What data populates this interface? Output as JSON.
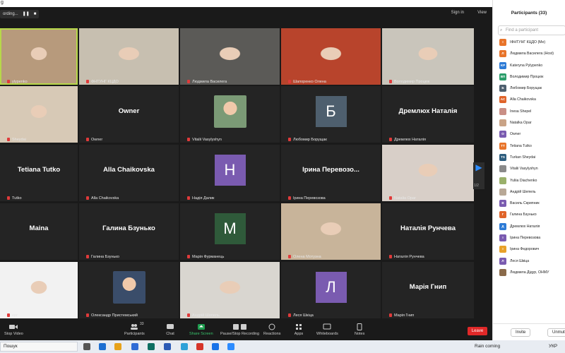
{
  "window": {
    "title": "g"
  },
  "recording": {
    "label": "ording...",
    "pause": "❚❚",
    "stop": "■"
  },
  "top_right": {
    "sign_in": "Sign in",
    "view": "View"
  },
  "tiles": [
    {
      "id": "t1",
      "name": "ylypenko",
      "kind": "video",
      "bg": "#b79a7c",
      "active": true
    },
    {
      "id": "t2",
      "name": "ФНТУНГ КЦДО",
      "kind": "video",
      "bg": "#c7bfb0"
    },
    {
      "id": "t3",
      "name": "Людмила Василега",
      "kind": "video",
      "bg": "#5b5a57"
    },
    {
      "id": "t4",
      "name": "Шапоренко Олена",
      "kind": "video",
      "bg": "#b8442c"
    },
    {
      "id": "t5",
      "name": "Володимир Процюк",
      "kind": "video",
      "bg": "#c9c5bb"
    },
    {
      "id": "t6",
      "name": "Shеydai",
      "kind": "video",
      "bg": "#d7c9b6"
    },
    {
      "id": "t7",
      "name": "Owner",
      "kind": "text",
      "big": "Owner"
    },
    {
      "id": "t8",
      "name": "Vitalii Vasylyshyn",
      "kind": "photo",
      "bg": "#7b9a76"
    },
    {
      "id": "t9",
      "name": "Любомир Борущак",
      "kind": "avatar",
      "letter": "Б",
      "bg": "#4e5f6e"
    },
    {
      "id": "t10",
      "name": "Дремлюх Наталія",
      "kind": "text",
      "big": "Дремлюх Наталія"
    },
    {
      "id": "t11",
      "name": "Tutko",
      "kind": "text",
      "big": "Tetiana Tutko"
    },
    {
      "id": "t12",
      "name": "Alla Chaikovska",
      "kind": "text",
      "big": "Alla Chaikovska"
    },
    {
      "id": "t13",
      "name": "Надія Далик",
      "kind": "avatar",
      "letter": "Н",
      "bg": "#7a5bb0"
    },
    {
      "id": "t14",
      "name": "Ірина Перевозова",
      "kind": "text",
      "big": "Ірина  Перевозо..."
    },
    {
      "id": "t15",
      "name": "Natalia Opar",
      "kind": "video",
      "bg": "#d8cfc8"
    },
    {
      "id": "t16",
      "name": "",
      "kind": "text",
      "big": "Maina"
    },
    {
      "id": "t17",
      "name": "Галина Бзунько",
      "kind": "text",
      "big": "Галина Бзунько"
    },
    {
      "id": "t18",
      "name": "Марія Фурманець",
      "kind": "avatar",
      "letter": "М",
      "bg": "#2f5a3a"
    },
    {
      "id": "t19",
      "name": "Олена Мотузна",
      "kind": "video",
      "bg": "#c8b49a"
    },
    {
      "id": "t20",
      "name": "Наталія Рунчева",
      "kind": "text",
      "big": "Наталія Рунчева"
    },
    {
      "id": "t21",
      "name": "ерг",
      "kind": "video",
      "bg": "#f2f2f2"
    },
    {
      "id": "t22",
      "name": "Олександр Пристемський",
      "kind": "photo",
      "bg": "#3a4d6a"
    },
    {
      "id": "t23",
      "name": "Андрій Шепель",
      "kind": "video",
      "bg": "#d9d6d0"
    },
    {
      "id": "t24",
      "name": "Леся Шкіца",
      "kind": "avatar",
      "letter": "Л",
      "bg": "#7a5bb0"
    },
    {
      "id": "t25",
      "name": "Марія Гнип",
      "kind": "text",
      "big": "Марія Гнип"
    }
  ],
  "pager": {
    "arrow": "▶",
    "page": "1/2"
  },
  "toolbar": {
    "stop_video": "Stop Video",
    "participants": "Participants",
    "participants_count": "33",
    "chat": "Chat",
    "share_screen": "Share Screen",
    "pause_recording": "Pause/Stop Recording",
    "reactions": "Reactions",
    "apps": "Apps",
    "whiteboards": "Whiteboards",
    "notes": "Notes",
    "leave": "Leave"
  },
  "panel": {
    "title": "Participants (33)",
    "search_placeholder": "Find a participant",
    "invite": "Invite",
    "unmute": "Unmute"
  },
  "participants": [
    {
      "initials": "I",
      "name": "ІФНТУНГ КЦДО (Me)",
      "color": "#e8742a"
    },
    {
      "initials": "Л",
      "name": "Людмила Василега (Host)",
      "color": "#e8742a"
    },
    {
      "initials": "KP",
      "name": "Kateryna Pylypenko",
      "color": "#2d7bd6"
    },
    {
      "initials": "ВП",
      "name": "Володимир Процюк",
      "color": "#2a9d6a"
    },
    {
      "initials": "Б",
      "name": "Любомир Борущак",
      "color": "#4e5f6e"
    },
    {
      "initials": "AC",
      "name": "Alla Chaikovska",
      "color": "#e0642a"
    },
    {
      "initials": "",
      "name": "Inesa Shepel",
      "color": "#c98f86"
    },
    {
      "initials": "",
      "name": "Natalka Opar",
      "color": "#c9a386"
    },
    {
      "initials": "O",
      "name": "Owner",
      "color": "#7a5bb0"
    },
    {
      "initials": "TT",
      "name": "Tetiana Tutko",
      "color": "#e8742a"
    },
    {
      "initials": "TS",
      "name": "Turkan Sheydai",
      "color": "#2d5d7e"
    },
    {
      "initials": "",
      "name": "Vitalii Vasylyshyn",
      "color": "#8a8a8a"
    },
    {
      "initials": "",
      "name": "Yuliia Diachenko",
      "color": "#9ab06a"
    },
    {
      "initials": "",
      "name": "Андрій Шепель",
      "color": "#b8a896"
    },
    {
      "initials": "В",
      "name": "Василь Скрипник",
      "color": "#7a5bb0"
    },
    {
      "initials": "Г",
      "name": "Галина Бзунько",
      "color": "#e0642a"
    },
    {
      "initials": "Д",
      "name": "Дремлюх Наталія",
      "color": "#2d7bd6"
    },
    {
      "initials": "І",
      "name": "Ірина Перевозова",
      "color": "#7a5bb0"
    },
    {
      "initials": "І",
      "name": "Ірина Федорович",
      "color": "#e8a12a"
    },
    {
      "initials": "Л",
      "name": "Леся Шкіца",
      "color": "#7a5bb0"
    },
    {
      "initials": "",
      "name": "Людмила Дідур, ОНМУ",
      "color": "#8a6a4a"
    }
  ],
  "taskbar": {
    "search": "Пошук",
    "weather": "Rain coming",
    "lang": "УКР"
  }
}
